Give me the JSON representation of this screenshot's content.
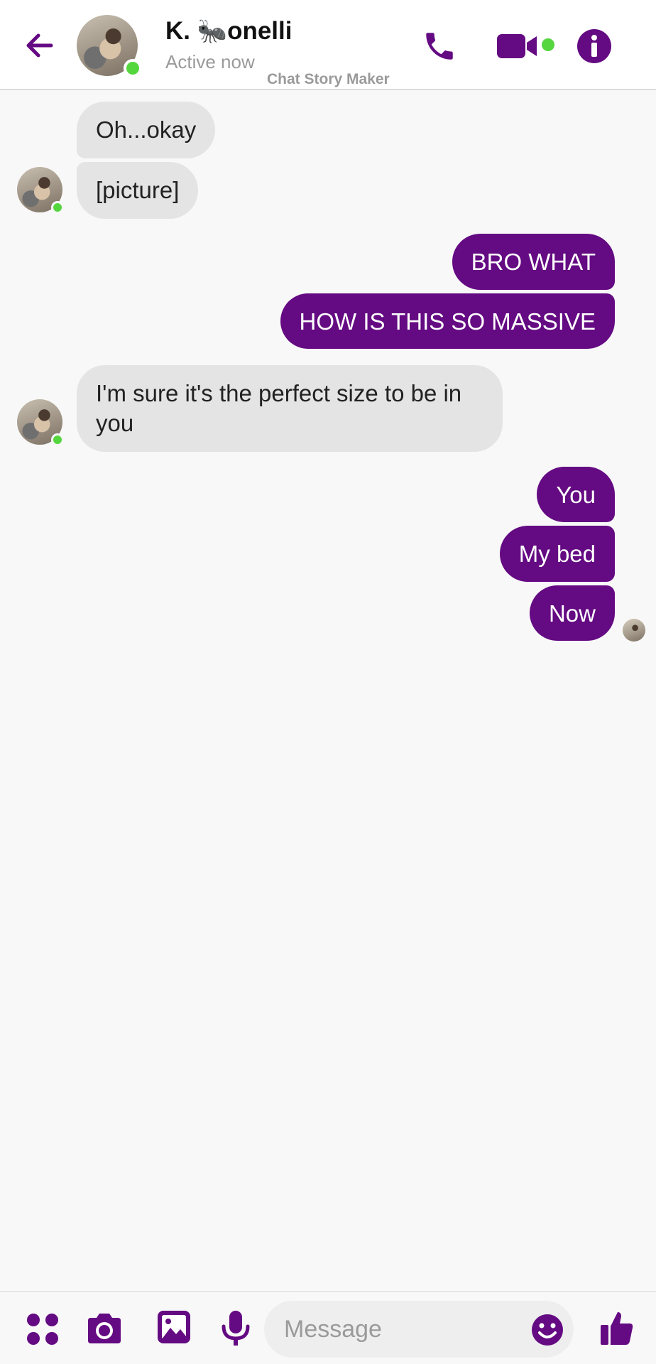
{
  "header": {
    "contact_name_prefix": "K. ",
    "contact_name_emoji": "🐜",
    "contact_name_suffix": "onelli",
    "status": "Active now",
    "watermark": "Chat Story Maker"
  },
  "messages": [
    {
      "direction": "incoming",
      "text": "Oh...okay"
    },
    {
      "direction": "incoming",
      "text": "[picture]"
    },
    {
      "direction": "outgoing",
      "text": "BRO WHAT"
    },
    {
      "direction": "outgoing",
      "text": "HOW IS THIS SO MASSIVE"
    },
    {
      "direction": "incoming",
      "text": "I'm sure it's the perfect size to be in you"
    },
    {
      "direction": "outgoing",
      "text": "You"
    },
    {
      "direction": "outgoing",
      "text": "My bed"
    },
    {
      "direction": "outgoing",
      "text": "Now"
    }
  ],
  "composer": {
    "placeholder": "Message"
  },
  "colors": {
    "accent": "#640a82",
    "incoming_bubble": "#e4e4e4",
    "online": "#55d63f",
    "background": "#f8f8f8"
  },
  "icons": [
    "back-arrow-icon",
    "phone-icon",
    "video-camera-icon",
    "info-icon",
    "apps-icon",
    "camera-icon",
    "gallery-icon",
    "microphone-icon",
    "emoji-icon",
    "thumbs-up-icon"
  ]
}
